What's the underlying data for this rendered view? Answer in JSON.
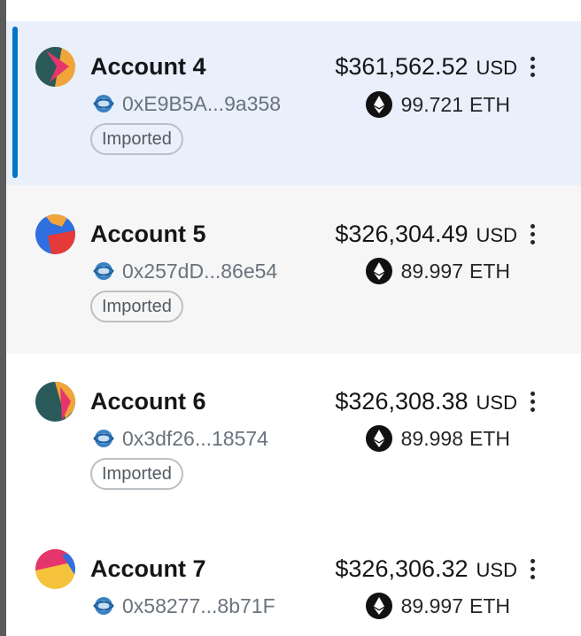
{
  "accounts": [
    {
      "name": "Account 4",
      "address": "0xE9B5A...9a358",
      "tag": "Imported",
      "fiat_value": "$361,562.52",
      "fiat_currency": "USD",
      "eth_value": "99.721",
      "eth_currency": "ETH",
      "selected": true,
      "avatar_colors": [
        "#f1a43a",
        "#e6356c",
        "#2b5a5a"
      ]
    },
    {
      "name": "Account 5",
      "address": "0x257dD...86e54",
      "tag": "Imported",
      "fiat_value": "$326,304.49",
      "fiat_currency": "USD",
      "eth_value": "89.997",
      "eth_currency": "ETH",
      "selected": false,
      "avatar_colors": [
        "#f1a43a",
        "#2f6fe0",
        "#e53a3a"
      ]
    },
    {
      "name": "Account 6",
      "address": "0x3df26...18574",
      "tag": "Imported",
      "fiat_value": "$326,308.38",
      "fiat_currency": "USD",
      "eth_value": "89.998",
      "eth_currency": "ETH",
      "selected": false,
      "avatar_colors": [
        "#f1a43a",
        "#e6356c",
        "#2b5a5a"
      ]
    },
    {
      "name": "Account 7",
      "address": "0x58277...8b71F",
      "fiat_value": "$326,306.32",
      "fiat_currency": "USD",
      "eth_value": "89.997",
      "eth_currency": "ETH",
      "selected": false,
      "avatar_colors": [
        "#f5c33b",
        "#e6356c",
        "#2f6fe0"
      ]
    }
  ],
  "colors": {
    "selected_bg": "#e9f0fb",
    "selected_bar": "#0376c9",
    "hover_bg": "#f6f6f6",
    "address_text": "#6a737d",
    "tag_border": "#bbc0c5"
  },
  "icons": {
    "network": "network-globe-icon",
    "token": "eth-icon",
    "menu": "kebab-menu-icon"
  }
}
